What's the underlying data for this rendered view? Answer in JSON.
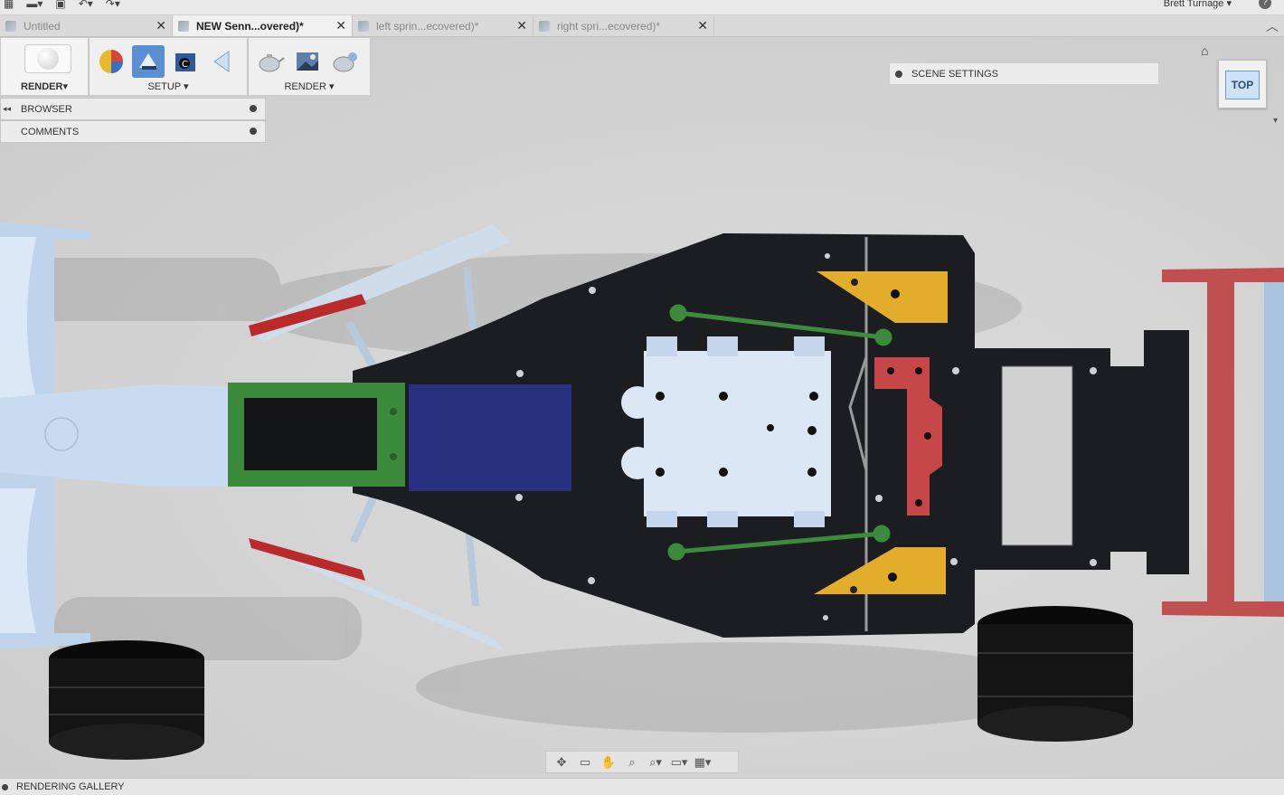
{
  "topbar": {
    "user_name": "Brett Turnage ▾",
    "help_label": "?"
  },
  "tabs": [
    {
      "label": "Untitled",
      "active": false
    },
    {
      "label": "NEW Senn...overed)*",
      "active": true
    },
    {
      "label": "left sprin...ecovered)*",
      "active": false
    },
    {
      "label": "right spri...ecovered)*",
      "active": false
    }
  ],
  "toolbar": {
    "workspace_label": "RENDER▾",
    "setup_label": "SETUP ▾",
    "render_label": "RENDER ▾"
  },
  "browser": {
    "browser_label": "BROWSER",
    "comments_label": "COMMENTS"
  },
  "scene_settings": {
    "label": "SCENE SETTINGS"
  },
  "viewcube": {
    "face_label": "TOP"
  },
  "gallery": {
    "label": "RENDERING GALLERY"
  },
  "colors": {
    "chassis": "#1b1d21",
    "nose": "#c9dbf0",
    "green_part": "#3c8a3c",
    "blue_part": "#27317f",
    "yellow_part": "#e3ad2c",
    "red_part": "#c64747",
    "accent_blue": "#5b8fd0"
  }
}
